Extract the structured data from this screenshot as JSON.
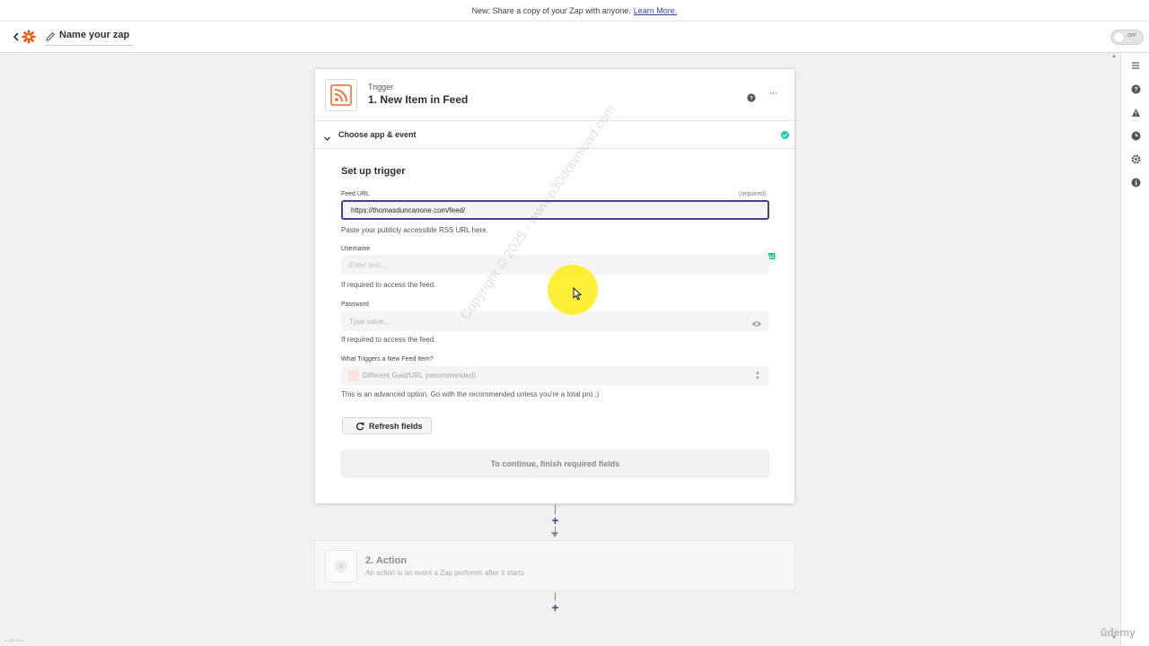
{
  "banner": {
    "text": "New: Share a copy of your Zap with anyone.",
    "link": "Learn More."
  },
  "topbar": {
    "zap_name": "Name your zap",
    "toggle_label": "OFF"
  },
  "trigger": {
    "label": "Trigger",
    "title": "1. New Item in Feed",
    "section_title": "Choose app & event",
    "setup_title": "Set up trigger",
    "feed_url": {
      "label": "Feed URL",
      "required": "(required)",
      "value": "https://thomasduncanone.com/feed/",
      "hint": "Paste your publicly accessible RSS URL here."
    },
    "username": {
      "label": "Username",
      "placeholder": "Enter text...",
      "hint": "If required to access the feed."
    },
    "password": {
      "label": "Password",
      "placeholder": "Type value...",
      "hint": "If required to access the feed."
    },
    "what_triggers": {
      "label": "What Triggers a New Feed Item?",
      "value": "Different Guid/URL (recommended)",
      "hint": "This is an advanced option. Go with the recommended unless you're a total pro ;)"
    },
    "refresh_label": "Refresh fields",
    "continue_label": "To continue, finish required fields"
  },
  "action": {
    "title": "2. Action",
    "description": "An action is an event a Zap performs after it starts"
  },
  "watermark": "Copyright © 2025 - www.p30download.com",
  "udemy": "ûdemy",
  "footer_id": "sc-4f8c7dc1",
  "colors": {
    "accent": "#3d4592",
    "zapier_orange": "#ff4f00",
    "success": "#13d0ab",
    "highlight": "#ffea00"
  }
}
